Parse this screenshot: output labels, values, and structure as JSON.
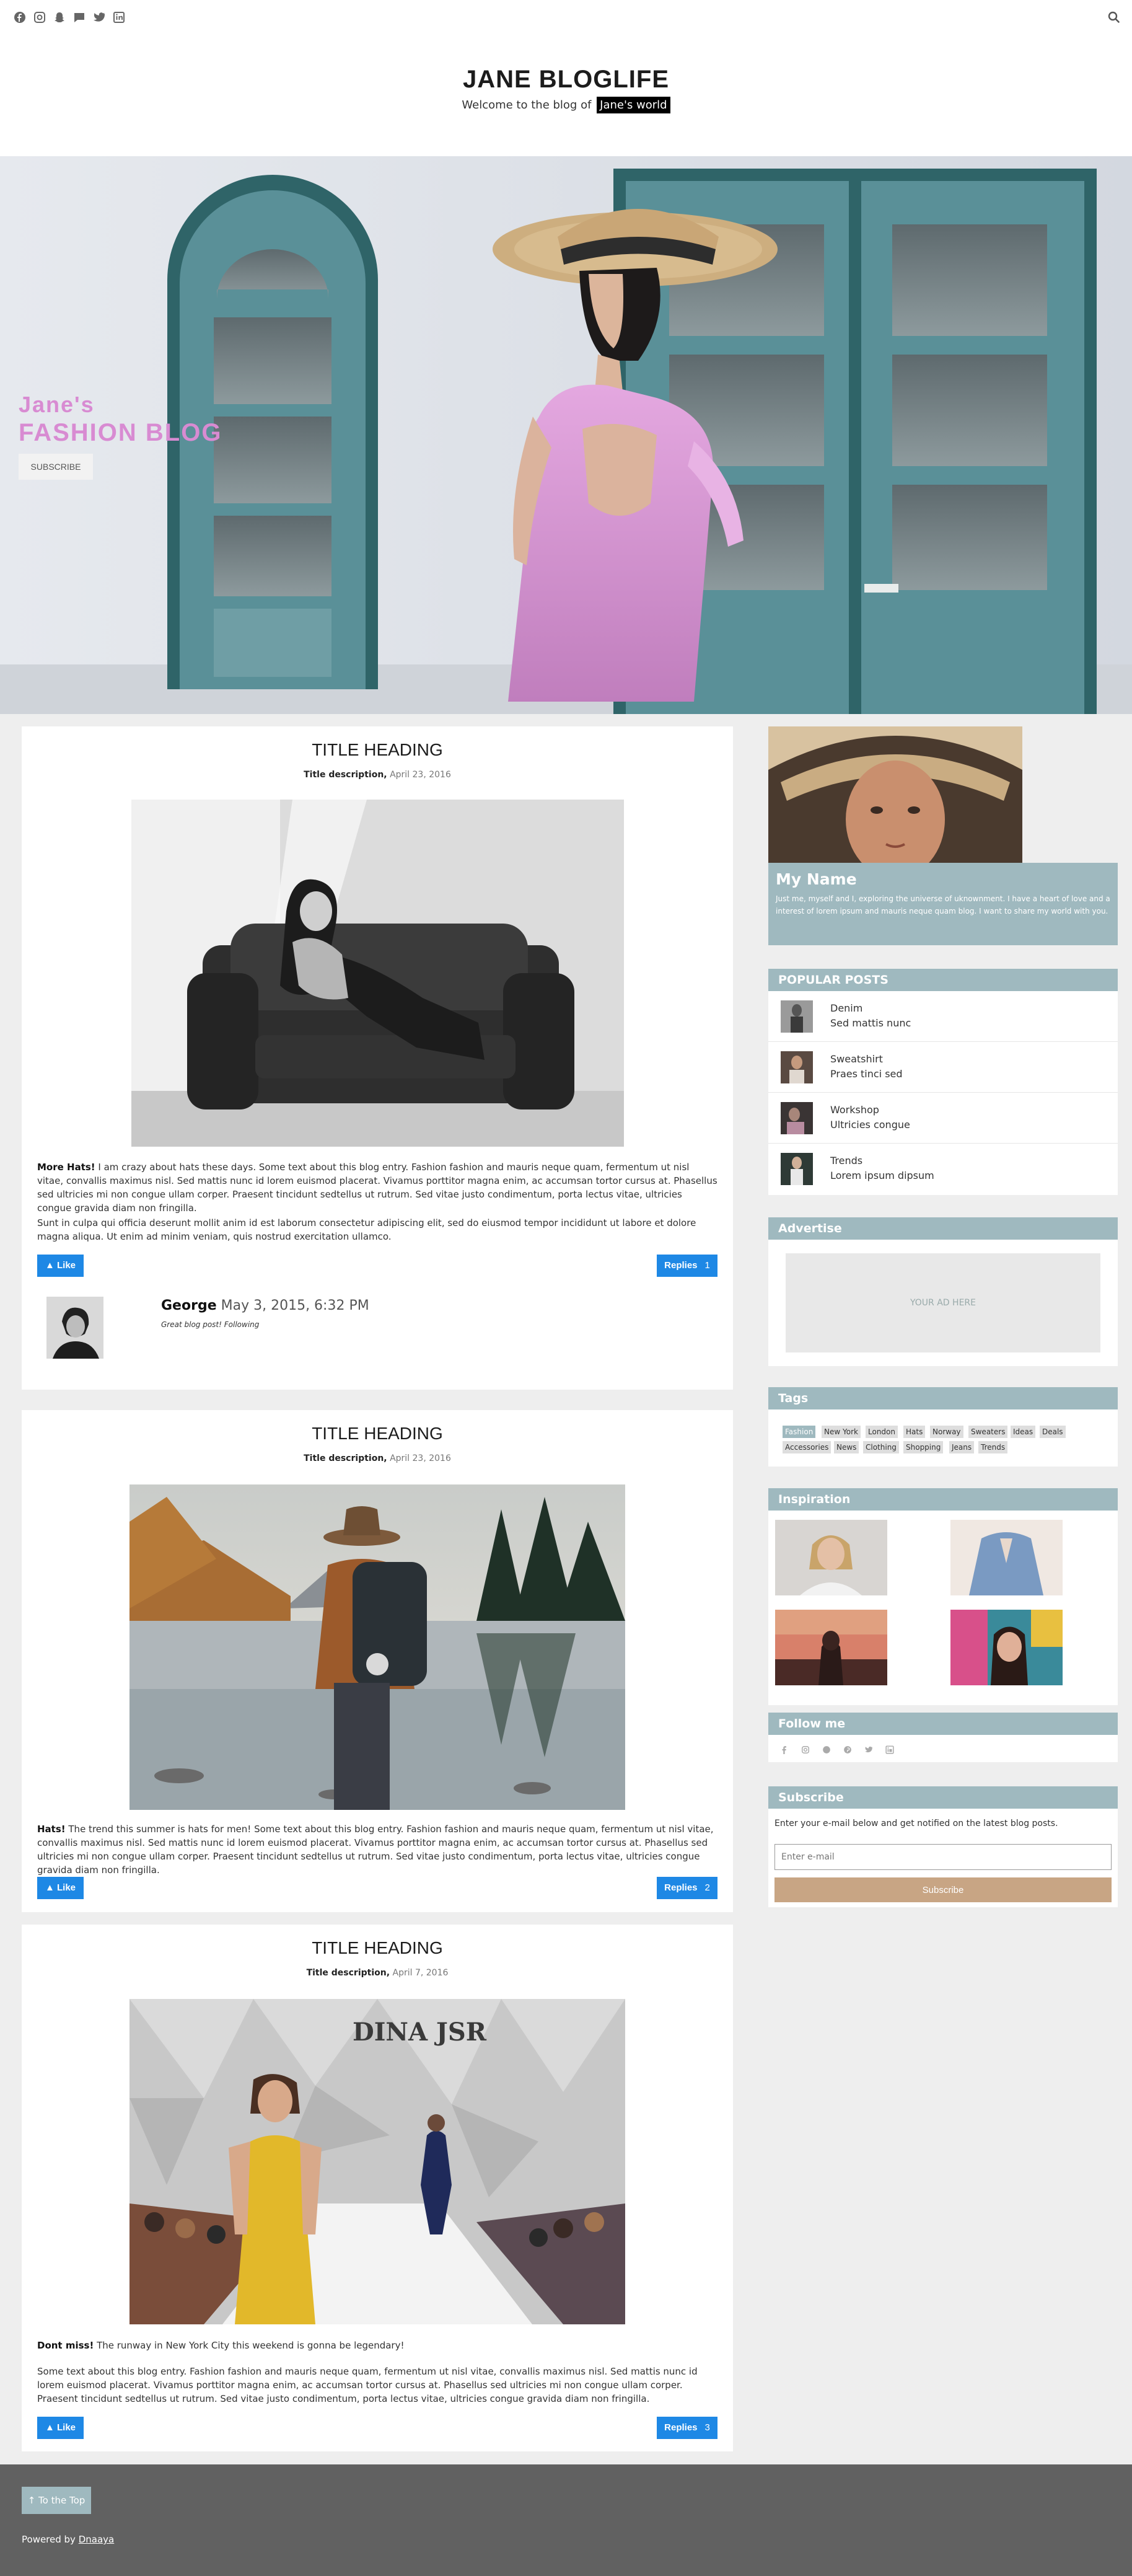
{
  "nav": {
    "icons": [
      "facebook-icon",
      "instagram-icon",
      "snapchat-icon",
      "pinterest-icon",
      "twitter-icon",
      "linkedin-icon"
    ],
    "search_icon": "search-icon"
  },
  "header": {
    "title": "JANE BLOGLIFE",
    "welcome": "Welcome to the blog of",
    "tag": "Jane's world"
  },
  "hero": {
    "line1": "Jane's",
    "line2": "FASHION BLOG",
    "button": "SUBSCRIBE"
  },
  "posts": [
    {
      "title": "TITLE HEADING",
      "desc_bold": "Title description,",
      "date": "April 23, 2016",
      "lead": "More Hats!",
      "text1": " I am crazy about hats these days. Some text about this blog entry. Fashion fashion and mauris neque quam, fermentum ut nisl vitae, convallis maximus nisl. Sed mattis nunc id lorem euismod placerat. Vivamus porttitor magna enim, ac accumsan tortor cursus at. Phasellus sed ultricies mi non congue ullam corper. Praesent tincidunt sedtellus ut rutrum. Sed vitae justo condimentum, porta lectus vitae, ultricies congue gravida diam non fringilla.",
      "text2": "Sunt in culpa qui officia deserunt mollit anim id est laborum consectetur adipiscing elit, sed do eiusmod tempor incididunt ut labore et dolore magna aliqua. Ut enim ad minim veniam, quis nostrud exercitation ullamco.",
      "like": "Like",
      "replies": "Replies",
      "reply_count": "1",
      "comment": {
        "name": "George",
        "date": "May 3, 2015, 6:32 PM",
        "text": "Great blog post! Following"
      }
    },
    {
      "title": "TITLE HEADING",
      "desc_bold": "Title description,",
      "date": "April 23, 2016",
      "lead": "Hats!",
      "text1": " The trend this summer is hats for men! Some text about this blog entry. Fashion fashion and mauris neque quam, fermentum ut nisl vitae, convallis maximus nisl. Sed mattis nunc id lorem euismod placerat. Vivamus porttitor magna enim, ac accumsan tortor cursus at. Phasellus sed ultricies mi non congue ullam corper. Praesent tincidunt sedtellus ut rutrum. Sed vitae justo condimentum, porta lectus vitae, ultricies congue gravida diam non fringilla.",
      "like": "Like",
      "replies": "Replies",
      "reply_count": "2"
    },
    {
      "title": "TITLE HEADING",
      "desc_bold": "Title description,",
      "date": "April 7, 2016",
      "lead": "Dont miss!",
      "text1": " The runway in New York City this weekend is gonna be legendary!",
      "text2": "Some text about this blog entry. Fashion fashion and mauris neque quam, fermentum ut nisl vitae, convallis maximus nisl. Sed mattis nunc id lorem euismod placerat. Vivamus porttitor magna enim, ac accumsan tortor cursus at. Phasellus sed ultricies mi non congue ullam corper. Praesent tincidunt sedtellus ut rutrum. Sed vitae justo condimentum, porta lectus vitae, ultricies congue gravida diam non fringilla.",
      "like": "Like",
      "replies": "Replies",
      "reply_count": "3",
      "banner": "DINA JSR"
    }
  ],
  "profile": {
    "name": "My Name",
    "bio": "Just me, myself and I, exploring the universe of uknownment. I have a heart of love and a interest of lorem ipsum and mauris neque quam blog. I want to share my world with you."
  },
  "popular": {
    "heading": "POPULAR POSTS",
    "items": [
      {
        "title": "Denim",
        "sub": "Sed mattis nunc"
      },
      {
        "title": "Sweatshirt",
        "sub": "Praes tinci sed"
      },
      {
        "title": "Workshop",
        "sub": "Ultricies congue"
      },
      {
        "title": "Trends",
        "sub": "Lorem ipsum dipsum"
      }
    ]
  },
  "advertise": {
    "heading": "Advertise",
    "ad": "YOUR AD HERE"
  },
  "tags": {
    "heading": "Tags",
    "items": [
      "Fashion",
      "New York",
      "London",
      "Hats",
      "Norway",
      "Sweaters",
      "Ideas",
      "Deals",
      "Accessories",
      "News",
      "Clothing",
      "Shopping",
      "Jeans",
      "Trends"
    ]
  },
  "inspiration": {
    "heading": "Inspiration"
  },
  "follow": {
    "heading": "Follow me",
    "icons": [
      "facebook-icon",
      "instagram-icon",
      "snapchat-icon",
      "pinterest-icon",
      "twitter-icon",
      "linkedin-icon"
    ]
  },
  "subscribe": {
    "heading": "Subscribe",
    "text": "Enter your e-mail below and get notified on the latest blog posts.",
    "placeholder": "Enter e-mail",
    "button": "Subscribe"
  },
  "footer": {
    "top": "To the Top",
    "powered": "Powered by",
    "link": "Dnaaya"
  },
  "colors": {
    "accent": "#9fb9bf",
    "button_blue": "#1e88e5",
    "subscribe": "#c8a584",
    "hero_text": "#d88bd2"
  }
}
